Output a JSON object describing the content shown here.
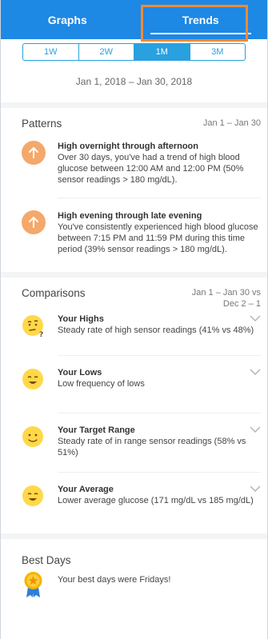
{
  "header": {
    "tabs": [
      {
        "label": "Graphs",
        "active": false
      },
      {
        "label": "Trends",
        "active": true
      }
    ],
    "highlight_color": "#f08a32",
    "bar_color": "#1e88e5"
  },
  "range": {
    "options": [
      "1W",
      "2W",
      "1M",
      "3M"
    ],
    "selected": "1M",
    "accent": "#29a0e0"
  },
  "date_range": "Jan 1, 2018 – Jan 30, 2018",
  "patterns": {
    "title": "Patterns",
    "period": "Jan 1 – Jan 30",
    "items": [
      {
        "icon": "arrow-up-icon",
        "title": "High overnight through afternoon",
        "text": "Over 30 days, you've had a trend of high blood glucose between 12:00 AM and 12:00 PM (50% sensor readings > 180 mg/dL)."
      },
      {
        "icon": "arrow-up-icon",
        "title": "High evening through late evening",
        "text": "You've consistently experienced high blood glucose between 7:15 PM and 11:59 PM during this time period (39% sensor readings > 180 mg/dL)."
      }
    ]
  },
  "comparisons": {
    "title": "Comparisons",
    "period_line1": "Jan 1 – Jan 30 vs",
    "period_line2": "Dec 2 – 1",
    "items": [
      {
        "icon": "thinking-face-icon",
        "title": "Your Highs",
        "text": "Steady rate of high sensor readings (41% vs 48%)"
      },
      {
        "icon": "winking-face-icon",
        "title": "Your Lows",
        "text": "Low frequency of lows"
      },
      {
        "icon": "smiling-face-icon",
        "title": "Your Target Range",
        "text": "Steady rate of in range sensor readings (58% vs 51%)"
      },
      {
        "icon": "winking-face-icon",
        "title": "Your Average",
        "text": "Lower average glucose (171 mg/dL vs 185 mg/dL)"
      }
    ]
  },
  "best_days": {
    "title": "Best Days",
    "icon": "medal-icon",
    "text": "Your best days were Fridays!"
  }
}
